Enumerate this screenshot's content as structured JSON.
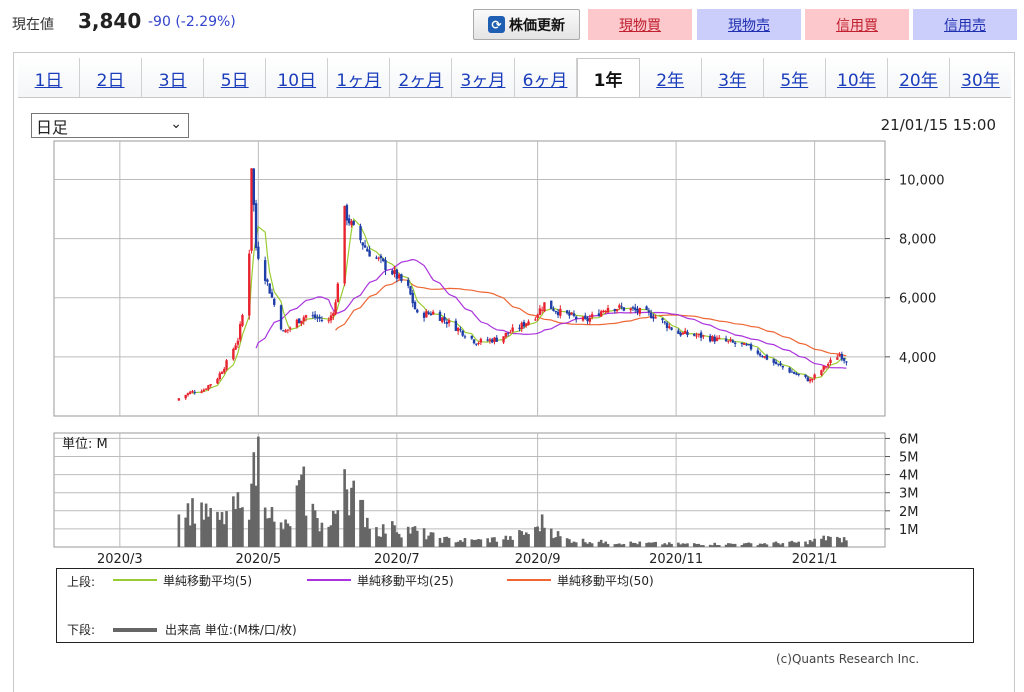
{
  "header": {
    "price_label": "現在値",
    "price_value": "3,840",
    "price_change": "-90 (-2.29%)",
    "refresh_label": "株価更新",
    "buttons": [
      "現物買",
      "現物売",
      "信用買",
      "信用売"
    ]
  },
  "tabs": [
    "1日",
    "2日",
    "3日",
    "5日",
    "10日",
    "1ヶ月",
    "2ヶ月",
    "3ヶ月",
    "6ヶ月",
    "1年",
    "2年",
    "3年",
    "5年",
    "10年",
    "20年",
    "30年"
  ],
  "active_tab": "1年",
  "period_select": "日足",
  "timestamp": "21/01/15 15:00",
  "copyright": "(c)Quants Research Inc.",
  "legend": {
    "upper_label": "上段:",
    "lower_label": "下段:",
    "items": [
      {
        "name": "単純移動平均(5)",
        "color": "#99cc33"
      },
      {
        "name": "単純移動平均(25)",
        "color": "#aa33dd"
      },
      {
        "name": "単純移動平均(50)",
        "color": "#ee6633"
      }
    ],
    "volume": {
      "name": "出来高 単位:(M株/口/枚)",
      "color": "#666666"
    }
  },
  "chart_data": [
    {
      "type": "candlestick",
      "panel": "price",
      "x_tick_labels": [
        "2020/3",
        "2020/5",
        "2020/7",
        "2020/9",
        "2020/11",
        "2021/1"
      ],
      "y_tick_labels": [
        "4,000",
        "6,000",
        "8,000",
        "10,000"
      ],
      "y_ticks": [
        4000,
        6000,
        8000,
        10000
      ],
      "ylim": [
        2000,
        11300
      ],
      "series_colors": {
        "up": "#e8222e",
        "down": "#1e3ea8"
      },
      "points": [
        {
          "date": "2020-03-27",
          "close": 2600
        },
        {
          "date": "2020-04-01",
          "close": 2800
        },
        {
          "date": "2020-04-07",
          "close": 2900
        },
        {
          "date": "2020-04-13",
          "close": 3300
        },
        {
          "date": "2020-04-17",
          "close": 3800
        },
        {
          "date": "2020-04-22",
          "close": 4600
        },
        {
          "date": "2020-04-24",
          "close": 5400
        },
        {
          "date": "2020-04-27",
          "close": 7600
        },
        {
          "date": "2020-04-28",
          "close": 10500
        },
        {
          "date": "2020-04-30",
          "close": 7700
        },
        {
          "date": "2020-05-07",
          "close": 6000
        },
        {
          "date": "2020-05-12",
          "close": 4800
        },
        {
          "date": "2020-05-18",
          "close": 5200
        },
        {
          "date": "2020-05-22",
          "close": 5400
        },
        {
          "date": "2020-05-27",
          "close": 5300
        },
        {
          "date": "2020-06-01",
          "close": 5200
        },
        {
          "date": "2020-06-04",
          "close": 5800
        },
        {
          "date": "2020-06-08",
          "close": 8900
        },
        {
          "date": "2020-06-12",
          "close": 8300
        },
        {
          "date": "2020-06-18",
          "close": 7600
        },
        {
          "date": "2020-06-24",
          "close": 7200
        },
        {
          "date": "2020-06-30",
          "close": 6800
        },
        {
          "date": "2020-07-06",
          "close": 6300
        },
        {
          "date": "2020-07-10",
          "close": 5400
        },
        {
          "date": "2020-07-17",
          "close": 5500
        },
        {
          "date": "2020-07-27",
          "close": 5000
        },
        {
          "date": "2020-08-05",
          "close": 4500
        },
        {
          "date": "2020-08-14",
          "close": 4600
        },
        {
          "date": "2020-08-24",
          "close": 5000
        },
        {
          "date": "2020-08-31",
          "close": 5400
        },
        {
          "date": "2020-09-04",
          "close": 5800
        },
        {
          "date": "2020-09-11",
          "close": 5500
        },
        {
          "date": "2020-09-22",
          "close": 5200
        },
        {
          "date": "2020-10-02",
          "close": 5700
        },
        {
          "date": "2020-10-12",
          "close": 5600
        },
        {
          "date": "2020-10-22",
          "close": 5400
        },
        {
          "date": "2020-11-02",
          "close": 4800
        },
        {
          "date": "2020-11-12",
          "close": 4700
        },
        {
          "date": "2020-11-24",
          "close": 4500
        },
        {
          "date": "2020-12-04",
          "close": 4300
        },
        {
          "date": "2020-12-14",
          "close": 3800
        },
        {
          "date": "2020-12-24",
          "close": 3400
        },
        {
          "date": "2020-12-30",
          "close": 3200
        },
        {
          "date": "2021-01-06",
          "close": 3700
        },
        {
          "date": "2021-01-12",
          "close": 4100
        },
        {
          "date": "2021-01-15",
          "close": 3840
        }
      ]
    },
    {
      "type": "bar",
      "panel": "volume",
      "ylabel": "単位: M",
      "y_tick_labels": [
        "1M",
        "2M",
        "3M",
        "4M",
        "5M",
        "6M"
      ],
      "y_ticks": [
        1,
        2,
        3,
        4,
        5,
        6
      ],
      "ylim": [
        0,
        6.3
      ],
      "series_color": "#666666",
      "points": [
        {
          "date": "2020-03-27",
          "v": 1.8
        },
        {
          "date": "2020-04-02",
          "v": 2.7
        },
        {
          "date": "2020-04-08",
          "v": 2.4
        },
        {
          "date": "2020-04-14",
          "v": 1.5
        },
        {
          "date": "2020-04-20",
          "v": 2.8
        },
        {
          "date": "2020-04-24",
          "v": 2.2
        },
        {
          "date": "2020-04-28",
          "v": 3.5
        },
        {
          "date": "2020-05-01",
          "v": 6.1
        },
        {
          "date": "2020-05-08",
          "v": 1.4
        },
        {
          "date": "2020-05-14",
          "v": 1.3
        },
        {
          "date": "2020-05-20",
          "v": 4.0
        },
        {
          "date": "2020-05-27",
          "v": 1.6
        },
        {
          "date": "2020-06-02",
          "v": 1.2
        },
        {
          "date": "2020-06-08",
          "v": 4.3
        },
        {
          "date": "2020-06-15",
          "v": 2.6
        },
        {
          "date": "2020-06-22",
          "v": 1.1
        },
        {
          "date": "2020-06-30",
          "v": 1.2
        },
        {
          "date": "2020-07-08",
          "v": 1.1
        },
        {
          "date": "2020-07-20",
          "v": 0.5
        },
        {
          "date": "2020-08-05",
          "v": 0.4
        },
        {
          "date": "2020-08-20",
          "v": 0.6
        },
        {
          "date": "2020-08-31",
          "v": 1.1
        },
        {
          "date": "2020-09-03",
          "v": 1.8
        },
        {
          "date": "2020-09-12",
          "v": 0.5
        },
        {
          "date": "2020-10-01",
          "v": 0.3
        },
        {
          "date": "2020-11-01",
          "v": 0.2
        },
        {
          "date": "2020-12-01",
          "v": 0.2
        },
        {
          "date": "2020-12-28",
          "v": 0.3
        },
        {
          "date": "2021-01-07",
          "v": 0.6
        },
        {
          "date": "2021-01-12",
          "v": 0.5
        }
      ]
    }
  ]
}
